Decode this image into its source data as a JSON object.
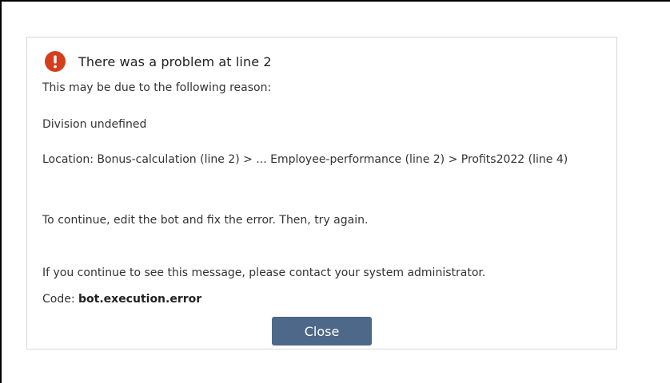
{
  "dialog": {
    "title": "There was a problem at line 2",
    "icon": "error-exclamation-icon",
    "icon_color": "#d43e1d",
    "reason_intro": "This may be due to the following reason:",
    "reason": "Division undefined",
    "location": "Location: Bonus-calculation (line 2) > ... Employee-performance (line 2) > Profits2022 (line 4)",
    "continue_instructions": "To continue, edit the bot and fix the error. Then, try again.",
    "contact_note": "If you continue to see this message, please contact your system administrator.",
    "code_label": "Code: ",
    "code_value": "bot.execution.error",
    "close_label": "Close",
    "close_color": "#4d6888"
  }
}
